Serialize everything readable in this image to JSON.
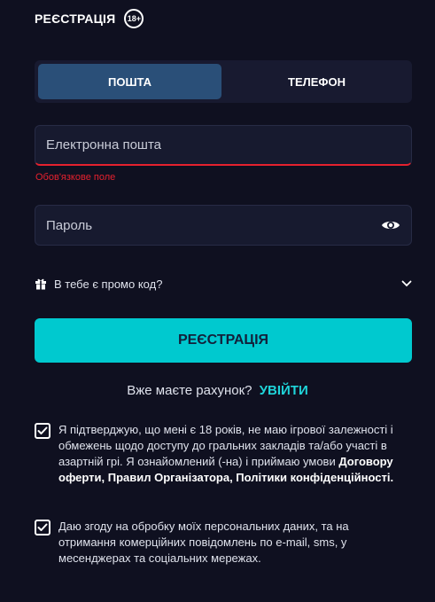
{
  "header": {
    "title": "РЕЄСТРАЦІЯ",
    "age_badge": "18+"
  },
  "tabs": [
    {
      "label": "ПОШТА",
      "active": true
    },
    {
      "label": "ТЕЛЕФОН",
      "active": false
    }
  ],
  "email": {
    "placeholder": "Електронна пошта",
    "value": "",
    "error": "Обов'язкове поле"
  },
  "password": {
    "placeholder": "Пароль",
    "value": ""
  },
  "promo": {
    "label": "В тебе є промо код?"
  },
  "submit": {
    "label": "РЕЄСТРАЦІЯ"
  },
  "login": {
    "prompt": "Вже маєте рахунок?",
    "link": "УВІЙТИ"
  },
  "consent1": {
    "checked": true,
    "text": "Я підтверджую, що мені є 18 років, не маю ігрової залежності і обмежень щодо доступу до гральних закладів та/або участі в азартній грі. Я ознайомлений (-на) і приймаю умови ",
    "bold": "Договору оферти, Правил Організатора, Політики конфіденційності."
  },
  "consent2": {
    "checked": true,
    "text": "Даю згоду на обробку моїх персональних даних, та на отримання комерційних повідомлень по e-mail, sms, у месенджерах та соціальних мережах."
  },
  "colors": {
    "background": "#0f1020",
    "accent": "#00c9cf",
    "error": "#e5212e",
    "active_tab": "#2a4f78"
  },
  "icons": [
    "gift-icon",
    "chevron-down-icon",
    "eye-icon",
    "checkmark-icon"
  ]
}
